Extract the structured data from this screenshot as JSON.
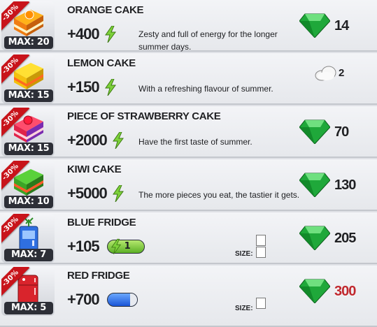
{
  "items": [
    {
      "discount": "-30%",
      "max_label": "MAX: 20",
      "name": "ORANGE CAKE",
      "gain": "+400",
      "description": "Zesty and full of energy for the longer summer days.",
      "price": "14",
      "currency": "emerald-gem-icon"
    },
    {
      "discount": "-30%",
      "max_label": "MAX: 15",
      "name": "LEMON CAKE",
      "gain": "+150",
      "description": "With a refreshing flavour of summer.",
      "price": "2",
      "currency": "cloud-icon"
    },
    {
      "discount": "-30%",
      "max_label": "MAX: 15",
      "name": "PIECE OF STRAWBERRY CAKE",
      "gain": "+2000",
      "description": "Have the first taste of summer.",
      "price": "70",
      "currency": "emerald-gem-icon"
    },
    {
      "discount": "-30%",
      "max_label": "MAX: 10",
      "name": "KIWI CAKE",
      "gain": "+5000",
      "description": "The more pieces you eat, the tastier it gets.",
      "price": "130",
      "currency": "emerald-gem-icon"
    },
    {
      "discount": "-30%",
      "max_label": "MAX: 7",
      "name": "BLUE FRIDGE",
      "gain": "+105",
      "energy_label": "1",
      "size_label": "SIZE:",
      "price": "205",
      "currency": "emerald-gem-icon"
    },
    {
      "discount": "-30%",
      "max_label": "MAX: 5",
      "name": "RED FRIDGE",
      "gain": "+700",
      "size_label": "SIZE:",
      "price": "300",
      "currency": "emerald-gem-icon",
      "price_color": "#c0282e"
    }
  ],
  "colors": {
    "ribbon": "#c8141b",
    "gem": "#1fa83a",
    "energy": "#5cb025",
    "storage": "#1a55d6"
  }
}
